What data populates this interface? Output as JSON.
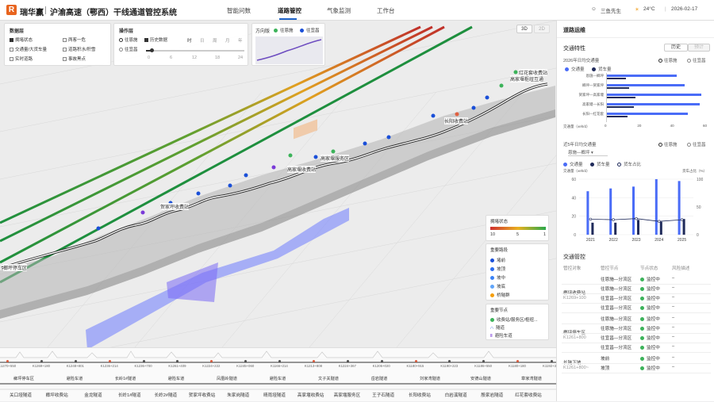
{
  "header": {
    "brand": "瑞华赢",
    "logo_char": "R",
    "title": "沪渝高速（鄂西）干线通道管控系统",
    "nav": [
      "智能问数",
      "道路管控",
      "气象监测",
      "工作台"
    ],
    "active_nav": 1,
    "user": "三鱼先生",
    "temp": "24°C",
    "date": "2026-02-17"
  },
  "data_layer": {
    "title": "数据层",
    "items": [
      {
        "label": "拥堵状态",
        "on": true
      },
      {
        "label": "两客一危",
        "on": false
      },
      {
        "label": "交通量/大货车量",
        "on": false
      },
      {
        "label": "道路积水/积雪",
        "on": false
      },
      {
        "label": "实时道路",
        "on": false
      },
      {
        "label": "事故黑点",
        "on": false
      }
    ]
  },
  "op_layer": {
    "title": "操作层",
    "options": [
      {
        "label": "往恩施",
        "type": "radio",
        "on": true
      },
      {
        "label": "历史数据",
        "type": "check",
        "on": true
      },
      {
        "label": "往宜昌",
        "type": "radio",
        "on": false
      }
    ],
    "hour_buttons": [
      "时",
      "日",
      "周",
      "月",
      "年"
    ],
    "ticks": [
      "0",
      "6",
      "12",
      "18",
      "24"
    ],
    "slider_pos": 0.06
  },
  "direction": {
    "title": "方向版",
    "opts": [
      "往恩施",
      "往宜昌"
    ]
  },
  "view": {
    "btn_3d": "3D",
    "btn_2d": "2D"
  },
  "congestion_legend": {
    "title": "拥堵状态",
    "min": "10",
    "mid": "5",
    "max": "1"
  },
  "road_legend": {
    "title": "重要路段",
    "items": [
      {
        "label": "堵前",
        "color": "#1a4fd8"
      },
      {
        "label": "坡顶",
        "color": "#2a6cf0"
      },
      {
        "label": "坡中",
        "color": "#3b82f6"
      },
      {
        "label": "坡底",
        "color": "#60a5fa"
      },
      {
        "label": "桥隧群",
        "color": "#f59e0b"
      }
    ]
  },
  "node_legend": {
    "title": "重要节点",
    "items": [
      "收费站/服务区/枢纽...",
      "隧道",
      "避险车道"
    ]
  },
  "map_labels": [
    {
      "t": "红花套收费站"
    },
    {
      "t": "高家堰枢纽互通"
    },
    {
      "t": "长阳收费站"
    },
    {
      "t": "高家堰服务区"
    },
    {
      "t": "高家堰收费站"
    },
    {
      "t": "贺家坪收费站"
    },
    {
      "t": "榔坪停车区"
    }
  ],
  "km_strip": [
    "K1270+550",
    "K1269+180",
    "K1248+801",
    "K1236+214",
    "K1236+700",
    "K1261+409",
    "K1224+222",
    "K1245+060",
    "K1166+214",
    "K1213+808",
    "K1224+367",
    "K1206+020",
    "K1180+915",
    "K1190+223",
    "K1186+550",
    "K1180+180",
    "K1192+308"
  ],
  "tunnels": [
    "关口垭隧道",
    "榔坪收费站",
    "金龙隧道",
    "长岭1#隧道",
    "长岭2#隧道",
    "贺家坪收费站",
    "朱家岗隧道",
    "晴雨垭隧道",
    "高家堰收费站",
    "高家堰服务区",
    "王子石隧道",
    "长阳收费站",
    "白岩溪隧道",
    "殷家岩隧道",
    "红花套收费站"
  ],
  "tunnels_top": [
    "榔坪停车区",
    "避险车道",
    "长岭1#隧道",
    "避险车道",
    "凤凰岭隧道",
    "避险车道",
    "文子关隧道",
    "岳岩隧道",
    "刘家湾隧道",
    "安德山隧道",
    "章家湾隧道"
  ],
  "side": {
    "title": "道路运维",
    "tab_hist": "历史",
    "tab_pred": "预计",
    "traffic_title": "交通特性",
    "traffic_sub": "2026年日均交通量",
    "dir1": "往恩施",
    "dir2": "往宜昌",
    "legend_a": "交通量",
    "legend_b": "货车量",
    "bars": [
      {
        "seg": "恩施—榔坪",
        "a": 43,
        "b": 12
      },
      {
        "seg": "榔坪—贺家坪",
        "a": 48,
        "b": 14
      },
      {
        "seg": "贺家坪—高家堰",
        "a": 58,
        "b": 18
      },
      {
        "seg": "高家堰—长阳",
        "a": 57,
        "b": 17
      },
      {
        "seg": "长阳—红花套",
        "a": 50,
        "b": 13
      }
    ],
    "bar_axis": [
      "0",
      "20",
      "40",
      "60"
    ],
    "bar_unit": "交通量（veh/d）",
    "year_title": "近5年日均交通量",
    "dir_select": "恩施—榔坪",
    "legend_c": "货车占比",
    "years": [
      "2021",
      "2022",
      "2023",
      "2024",
      "2025"
    ],
    "year_vals": [
      47,
      50,
      52,
      60,
      58
    ],
    "truck_vals": [
      13,
      13,
      16,
      14,
      17
    ],
    "ratio_vals": [
      28,
      27,
      29,
      24,
      27
    ],
    "ly": [
      "60",
      "40",
      "20",
      "0"
    ],
    "ry": [
      "100",
      "50",
      "0"
    ],
    "ly_unit": "交通量（veh/d）",
    "ry_unit": "货车占比（%）",
    "mgmt_title": "交通管控",
    "cols": [
      "管控对象",
      "管控节点",
      "节点状态",
      "风险描述"
    ],
    "groups": [
      {
        "obj": "榔坪收费站",
        "code": "K1269+100",
        "rows": [
          "往恩施—分流区",
          "往恩施—分流区",
          "往宜昌—分流区",
          "往宜昌—分流区"
        ]
      },
      {
        "obj": "榔坪停车区",
        "code": "K1261+800",
        "rows": [
          "往恩施—分流区",
          "往恩施—分流区",
          "往宜昌—分流区",
          "往宜昌—分流区"
        ]
      },
      {
        "obj": "长陡下坡",
        "code": "K1261+800~",
        "rows": [
          "坡前",
          "坡顶"
        ]
      }
    ],
    "status": "监控中",
    "risk": "–"
  }
}
